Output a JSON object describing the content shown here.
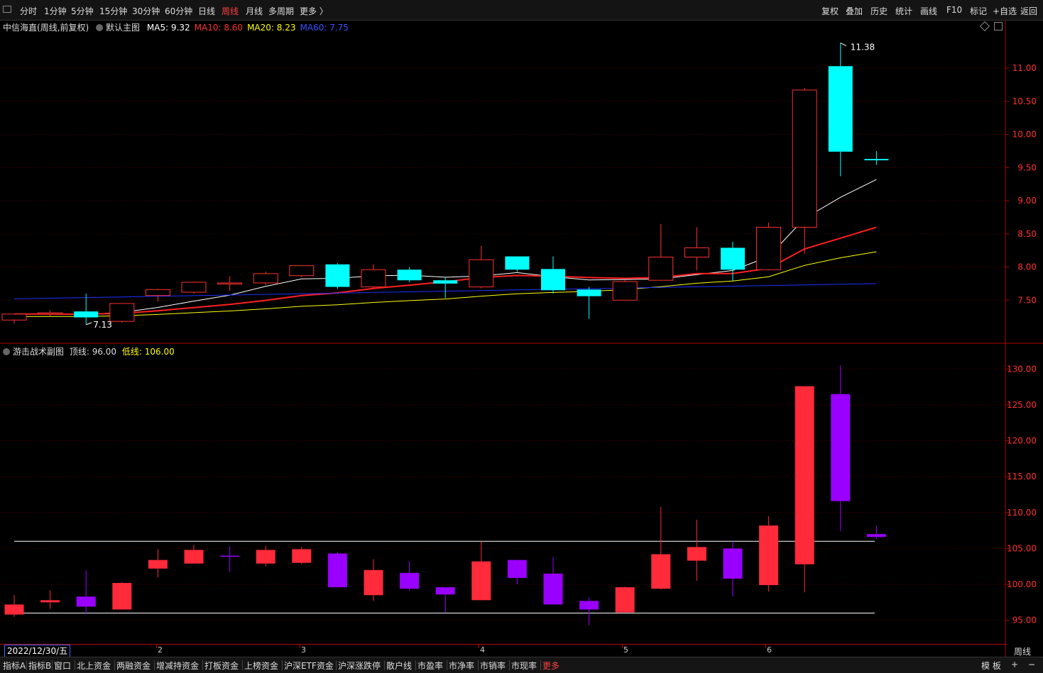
{
  "toolbar": {
    "periods": [
      "分时",
      "1分钟",
      "5分钟",
      "15分钟",
      "30分钟",
      "60分钟",
      "日线",
      "周线",
      "月线",
      "多周期",
      "更多 〉"
    ],
    "active_period": "周线",
    "right_buttons": [
      "复权",
      "叠加",
      "历史",
      "统计",
      "画线",
      "F10",
      "标记",
      "+自选",
      "返回"
    ]
  },
  "main_chart": {
    "stock_name": "中信海直",
    "period_adjust": "(周线,前复权)",
    "template": "默认主图",
    "ma_items": [
      {
        "label": "MA5: 9.32",
        "color": "#ffffff"
      },
      {
        "label": "MA10: 8.60",
        "color": "#ff3030"
      },
      {
        "label": "MA20: 8.23",
        "color": "#ffff00"
      },
      {
        "label": "MA60: 7.75",
        "color": "#3c50ff"
      }
    ],
    "high_label": "11.38",
    "low_label": "7.13"
  },
  "sub_chart": {
    "name": "游击战术副图",
    "top_line_label": "顶线: 96.00",
    "bottom_line_label": "低线: 106.00"
  },
  "date_bar": {
    "current_date": "2022/12/30/五",
    "month_labels": [
      "2",
      "3",
      "4",
      "5",
      "6"
    ],
    "period": "周线"
  },
  "bottom_tabs": [
    "指标A",
    "指标B",
    "窗口",
    "北上资金",
    "两融资金",
    "增减持资金",
    "打板资金",
    "上榜资金",
    "沪深ETF资金",
    "沪深涨跌停",
    "散户线",
    "市盈率",
    "市净率",
    "市销率",
    "市现率",
    "更多"
  ],
  "bottom_active": "更多",
  "bottom_right": [
    "模 板",
    "+",
    "−"
  ],
  "colors": {
    "up": "#ff3030",
    "down": "#00ffff",
    "ma5": "#ffffff",
    "ma10": "#ff2020",
    "ma20": "#ffff00",
    "ma60": "#2030ff",
    "sub_up": "#ff2a3a",
    "sub_down": "#9900ff"
  },
  "chart_data": [
    {
      "type": "candlestick",
      "title": "中信海直 (周线,前复权)",
      "y_ticks": [
        7.5,
        8.0,
        8.5,
        9.0,
        9.5,
        10.0,
        10.5,
        11.0
      ],
      "ylim": [
        7.0,
        11.6
      ],
      "candles": [
        {
          "o": 7.2,
          "h": 7.28,
          "l": 7.15,
          "c": 7.29
        },
        {
          "o": 7.3,
          "h": 7.35,
          "l": 7.26,
          "c": 7.31
        },
        {
          "o": 7.33,
          "h": 7.6,
          "l": 7.13,
          "c": 7.24
        },
        {
          "o": 7.18,
          "h": 7.45,
          "l": 7.16,
          "c": 7.45
        },
        {
          "o": 7.57,
          "h": 7.67,
          "l": 7.48,
          "c": 7.66
        },
        {
          "o": 7.62,
          "h": 7.78,
          "l": 7.6,
          "c": 7.77
        },
        {
          "o": 7.76,
          "h": 7.86,
          "l": 7.64,
          "c": 7.76
        },
        {
          "o": 7.76,
          "h": 7.93,
          "l": 7.73,
          "c": 7.9
        },
        {
          "o": 7.87,
          "h": 8.02,
          "l": 7.85,
          "c": 8.02
        },
        {
          "o": 8.04,
          "h": 8.06,
          "l": 7.67,
          "c": 7.7
        },
        {
          "o": 7.7,
          "h": 8.04,
          "l": 7.68,
          "c": 7.96
        },
        {
          "o": 7.96,
          "h": 8.0,
          "l": 7.77,
          "c": 7.8
        },
        {
          "o": 7.8,
          "h": 7.84,
          "l": 7.53,
          "c": 7.75
        },
        {
          "o": 7.7,
          "h": 8.32,
          "l": 7.68,
          "c": 8.11
        },
        {
          "o": 8.16,
          "h": 8.16,
          "l": 7.93,
          "c": 7.96
        },
        {
          "o": 7.97,
          "h": 8.16,
          "l": 7.6,
          "c": 7.65
        },
        {
          "o": 7.66,
          "h": 7.7,
          "l": 7.22,
          "c": 7.56
        },
        {
          "o": 7.5,
          "h": 7.8,
          "l": 7.5,
          "c": 7.78
        },
        {
          "o": 7.8,
          "h": 8.65,
          "l": 7.8,
          "c": 8.15
        },
        {
          "o": 8.15,
          "h": 8.6,
          "l": 7.95,
          "c": 8.29
        },
        {
          "o": 8.29,
          "h": 8.38,
          "l": 7.79,
          "c": 7.96
        },
        {
          "o": 7.96,
          "h": 8.67,
          "l": 7.95,
          "c": 8.6
        },
        {
          "o": 8.6,
          "h": 10.7,
          "l": 8.2,
          "c": 10.67
        },
        {
          "o": 11.03,
          "h": 11.38,
          "l": 9.37,
          "c": 9.74
        },
        {
          "o": 9.63,
          "h": 9.75,
          "l": 9.54,
          "c": 9.61
        }
      ],
      "ma_series": [
        {
          "name": "MA5",
          "last": 9.32
        },
        {
          "name": "MA10",
          "last": 8.6
        },
        {
          "name": "MA20",
          "last": 8.23
        },
        {
          "name": "MA60",
          "last": 7.75
        }
      ],
      "annotations": [
        {
          "text": "11.38",
          "type": "high"
        },
        {
          "text": "7.13",
          "type": "low"
        }
      ]
    },
    {
      "type": "candlestick",
      "title": "游击战术副图",
      "y_ticks": [
        95,
        100,
        105,
        110,
        115,
        120,
        125,
        130
      ],
      "ylim": [
        92.5,
        132
      ],
      "ref_lines": [
        96.0,
        106.0
      ],
      "candles": [
        {
          "o": 95.8,
          "h": 98.5,
          "l": 95.5,
          "c": 97.2
        },
        {
          "o": 97.5,
          "h": 99.2,
          "l": 96.6,
          "c": 97.8
        },
        {
          "o": 98.3,
          "h": 102.0,
          "l": 95.8,
          "c": 96.9
        },
        {
          "o": 96.5,
          "h": 100.3,
          "l": 96.5,
          "c": 100.2
        },
        {
          "o": 102.2,
          "h": 104.9,
          "l": 101.0,
          "c": 103.4
        },
        {
          "o": 102.9,
          "h": 105.5,
          "l": 102.9,
          "c": 104.8
        },
        {
          "o": 104.0,
          "h": 105.3,
          "l": 101.7,
          "c": 103.9
        },
        {
          "o": 102.9,
          "h": 105.4,
          "l": 102.5,
          "c": 104.8
        },
        {
          "o": 103.0,
          "h": 105.2,
          "l": 102.8,
          "c": 104.9
        },
        {
          "o": 104.3,
          "h": 104.5,
          "l": 99.6,
          "c": 99.6
        },
        {
          "o": 98.5,
          "h": 103.5,
          "l": 97.7,
          "c": 102.0
        },
        {
          "o": 101.6,
          "h": 103.2,
          "l": 99.1,
          "c": 99.4
        },
        {
          "o": 99.6,
          "h": 99.6,
          "l": 96.1,
          "c": 98.6
        },
        {
          "o": 97.8,
          "h": 106.0,
          "l": 97.8,
          "c": 103.2
        },
        {
          "o": 103.4,
          "h": 103.4,
          "l": 100.0,
          "c": 100.9
        },
        {
          "o": 101.5,
          "h": 103.8,
          "l": 97.2,
          "c": 97.2
        },
        {
          "o": 97.7,
          "h": 98.2,
          "l": 94.3,
          "c": 96.5
        },
        {
          "o": 96.1,
          "h": 99.7,
          "l": 96.1,
          "c": 99.6
        },
        {
          "o": 99.4,
          "h": 110.8,
          "l": 99.3,
          "c": 104.2
        },
        {
          "o": 103.3,
          "h": 109.0,
          "l": 100.5,
          "c": 105.2
        },
        {
          "o": 105.0,
          "h": 106.0,
          "l": 98.3,
          "c": 100.8
        },
        {
          "o": 99.9,
          "h": 109.5,
          "l": 99.0,
          "c": 108.2
        },
        {
          "o": 102.8,
          "h": 127.6,
          "l": 98.9,
          "c": 127.6
        },
        {
          "o": 126.5,
          "h": 130.5,
          "l": 107.4,
          "c": 111.6
        },
        {
          "o": 107.0,
          "h": 108.2,
          "l": 106.3,
          "c": 106.6
        }
      ]
    }
  ]
}
